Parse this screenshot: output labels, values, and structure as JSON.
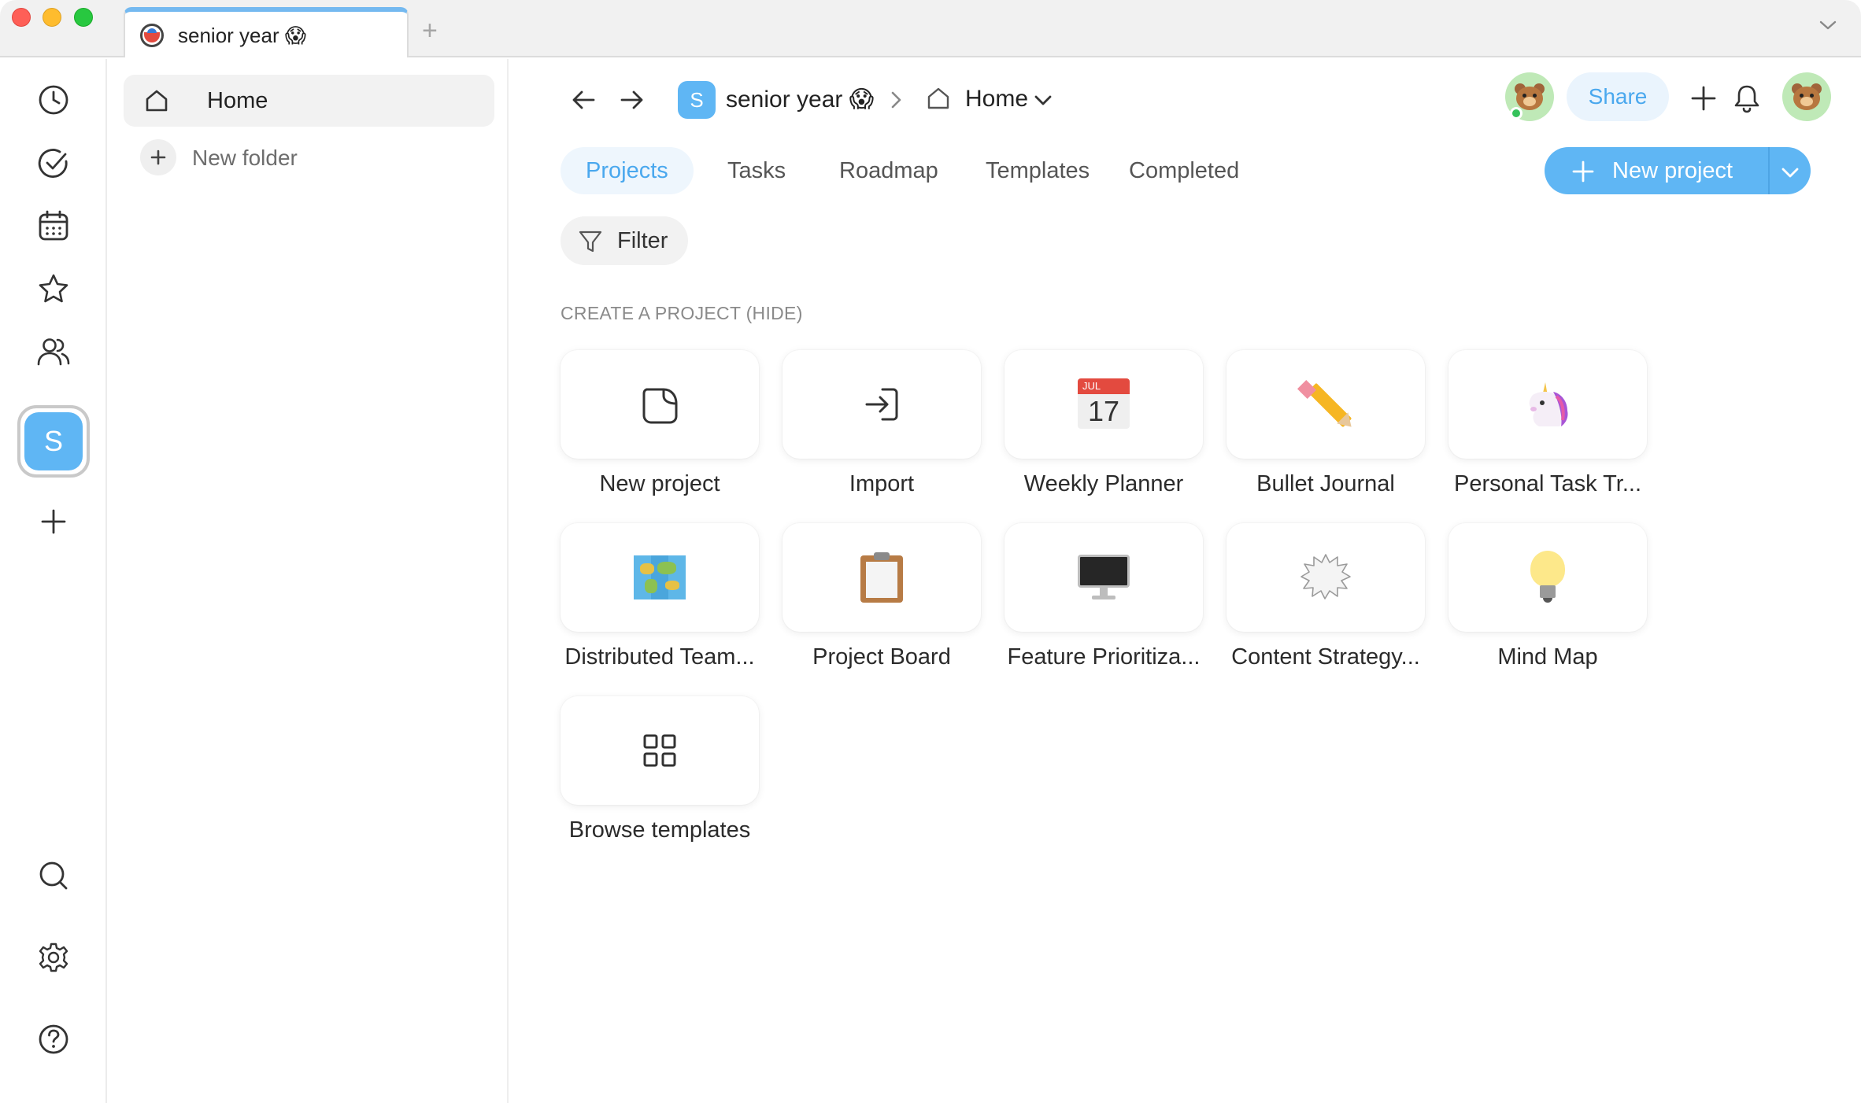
{
  "window": {
    "tab_title": "senior year 😱",
    "tab_add": "+"
  },
  "rail": {
    "workspace_initial": "S",
    "items": [
      "recent-icon",
      "tasks-icon",
      "calendar-icon",
      "favorites-icon",
      "people-icon"
    ],
    "bottom": [
      "search-icon",
      "gear-icon",
      "help-icon"
    ]
  },
  "sidebar": {
    "home_label": "Home",
    "new_folder_label": "New folder"
  },
  "header": {
    "workspace_initial": "S",
    "workspace_name": "senior year 😱",
    "location": "Home",
    "share_label": "Share"
  },
  "tabs": [
    {
      "label": "Projects",
      "active": true
    },
    {
      "label": "Tasks",
      "active": false
    },
    {
      "label": "Roadmap",
      "active": false
    },
    {
      "label": "Templates",
      "active": false
    },
    {
      "label": "Completed",
      "active": false
    }
  ],
  "new_project_button": "New project",
  "filter_label": "Filter",
  "section_label": "CREATE A PROJECT (HIDE)",
  "cards": [
    {
      "label": "New project",
      "icon": "new-project-icon"
    },
    {
      "label": "Import",
      "icon": "import-icon"
    },
    {
      "label": "Weekly Planner",
      "icon": "calendar-emoji",
      "cal_month": "JUL",
      "cal_day": "17"
    },
    {
      "label": "Bullet Journal",
      "icon": "pencil-emoji"
    },
    {
      "label": "Personal Task Tr...",
      "icon": "unicorn-emoji"
    },
    {
      "label": "Distributed Team...",
      "icon": "map-emoji"
    },
    {
      "label": "Project Board",
      "icon": "clipboard-emoji"
    },
    {
      "label": "Feature Prioritiza...",
      "icon": "monitor-emoji"
    },
    {
      "label": "Content Strategy...",
      "icon": "speech-burst-emoji"
    },
    {
      "label": "Mind Map",
      "icon": "lightbulb-emoji"
    },
    {
      "label": "Browse templates",
      "icon": "grid-icon"
    }
  ],
  "colors": {
    "accent": "#5fb6f4",
    "accent_text": "#4aa8ee",
    "accent_soft": "#eef6fd",
    "avatar_bg": "#bfe9b7",
    "presence": "#35c25b"
  }
}
